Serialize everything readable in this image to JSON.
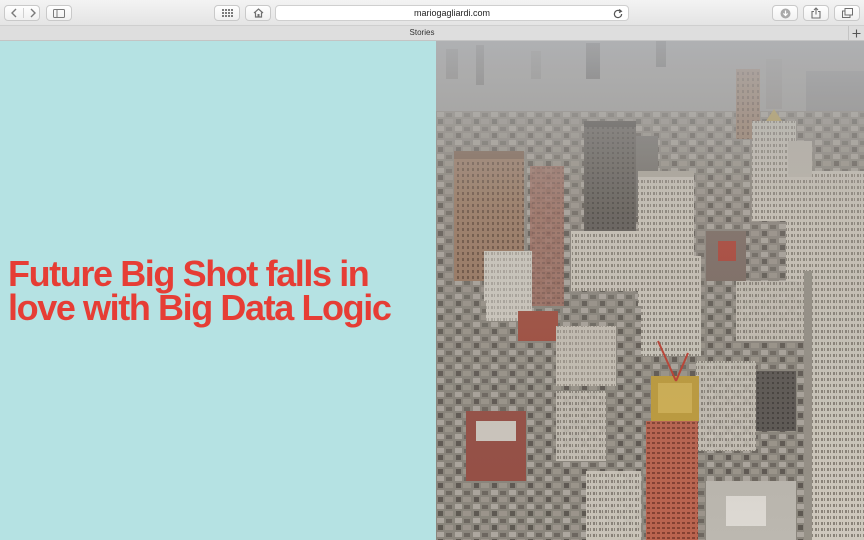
{
  "browser": {
    "address": "mariogagliardi.com",
    "tab_title": "Stories",
    "icons": [
      "back-icon",
      "forward-icon",
      "sidebar-icon",
      "grid-icon",
      "home-icon",
      "reload-icon",
      "downloads-icon",
      "share-icon",
      "tabs-overview-icon",
      "plus-icon"
    ]
  },
  "page": {
    "headline": "Future Big Shot falls in love with Big Data Logic",
    "colors": {
      "panel_background": "#b5e2e3",
      "headline": "#e63d35"
    }
  }
}
